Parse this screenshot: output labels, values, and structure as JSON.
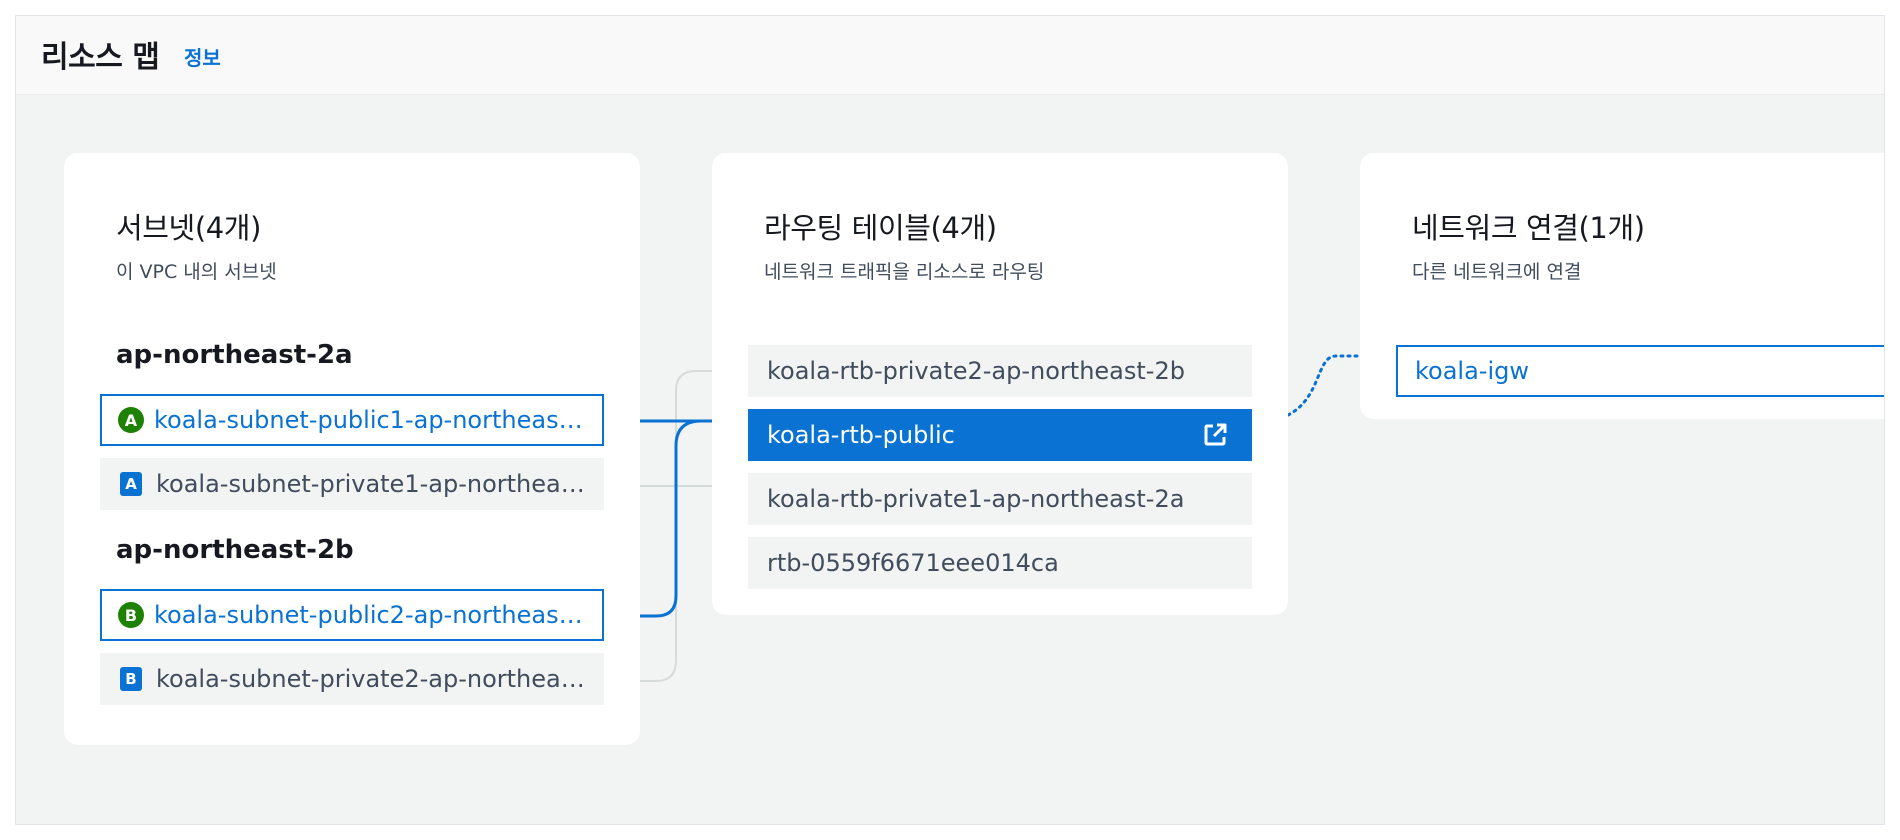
{
  "header": {
    "title": "리소스 맵",
    "info_link": "정보"
  },
  "subnets": {
    "title": "서브넷(4개)",
    "description": "이 VPC 내의 서브넷",
    "zones": [
      {
        "name": "ap-northeast-2a",
        "items": [
          {
            "badge": "A",
            "label": "koala-subnet-public1-ap-northeas…",
            "state": "selected"
          },
          {
            "badge": "A",
            "label": "koala-subnet-private1-ap-northea…",
            "state": "normal"
          }
        ]
      },
      {
        "name": "ap-northeast-2b",
        "items": [
          {
            "badge": "B",
            "label": "koala-subnet-public2-ap-northeas…",
            "state": "selected"
          },
          {
            "badge": "B",
            "label": "koala-subnet-private2-ap-northea…",
            "state": "normal"
          }
        ]
      }
    ]
  },
  "route_tables": {
    "title": "라우팅 테이블(4개)",
    "description": "네트워크 트래픽을 리소스로 라우팅",
    "items": [
      {
        "label": "koala-rtb-private2-ap-northeast-2b",
        "state": "normal"
      },
      {
        "label": "koala-rtb-public",
        "state": "active",
        "icon": "external-link-icon"
      },
      {
        "label": "koala-rtb-private1-ap-northeast-2a",
        "state": "normal"
      },
      {
        "label": "rtb-0559f6671eee014ca",
        "state": "normal"
      }
    ]
  },
  "network_connections": {
    "title": "네트워크 연결(1개)",
    "description": "다른 네트워크에 연결",
    "items": [
      {
        "label": "koala-igw",
        "state": "link"
      }
    ]
  },
  "colors": {
    "accent": "#0972d3",
    "selected_badge": "#1d8102",
    "connector_inactive": "#d5dbdb"
  }
}
